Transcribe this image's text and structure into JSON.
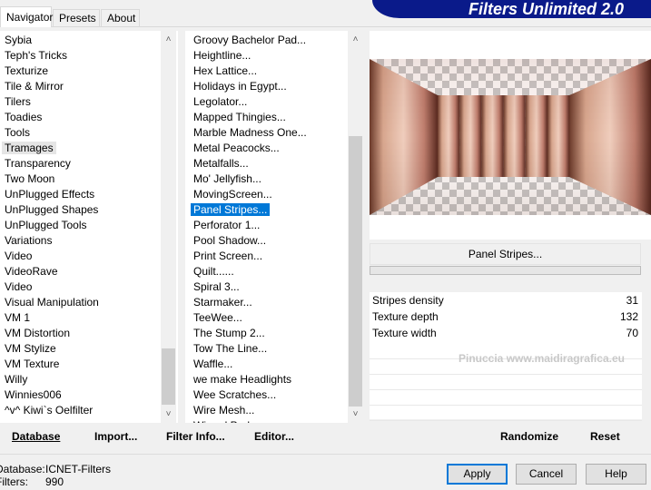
{
  "tabs": [
    "Navigator",
    "Presets",
    "About"
  ],
  "title": "Filters Unlimited 2.0",
  "categories": [
    "Sybia",
    "Teph's Tricks",
    "Texturize",
    "Tile & Mirror",
    "Tilers",
    "Toadies",
    "Tools",
    "Tramages",
    "Transparency",
    "Two Moon",
    "UnPlugged Effects",
    "UnPlugged Shapes",
    "UnPlugged Tools",
    "Variations",
    "Video",
    "VideoRave",
    "Video",
    "Visual Manipulation",
    "VM 1",
    "VM Distortion",
    "VM Stylize",
    "VM Texture",
    "Willy",
    "Winnies006",
    "^v^ Kiwi`s Oelfilter"
  ],
  "selected_category": "Tramages",
  "filters": [
    "Groovy Bachelor Pad...",
    "Heightline...",
    "Hex Lattice...",
    "Holidays in Egypt...",
    "Legolator...",
    "Mapped Thingies...",
    "Marble Madness One...",
    "Metal Peacocks...",
    "Metalfalls...",
    "Mo' Jellyfish...",
    "MovingScreen...",
    "Panel Stripes...",
    "Perforator 1...",
    "Pool Shadow...",
    "Print Screen...",
    "Quilt......",
    "Spiral 3...",
    "Starmaker...",
    "TeeWee...",
    "The Stump 2...",
    "Tow The Line...",
    "Waffle...",
    "we make Headlights",
    "Wee Scratches...",
    "Wire Mesh...",
    "Wizard Pad..."
  ],
  "selected_filter": "Panel Stripes...",
  "filter_button": "Panel Stripes...",
  "params": [
    {
      "label": "Stripes density",
      "value": "31"
    },
    {
      "label": "Texture depth",
      "value": "132"
    },
    {
      "label": "Texture width",
      "value": "70"
    }
  ],
  "watermark": "Pinuccia www.maidiragrafica.eu",
  "buttons": {
    "database": "Database",
    "import": "Import...",
    "filter_info": "Filter Info...",
    "editor": "Editor...",
    "randomize": "Randomize",
    "reset": "Reset",
    "apply": "Apply",
    "cancel": "Cancel",
    "help": "Help"
  },
  "status": {
    "database_label": "Database:",
    "database_value": "ICNET-Filters",
    "filters_label": "Filters:",
    "filters_value": "990"
  }
}
